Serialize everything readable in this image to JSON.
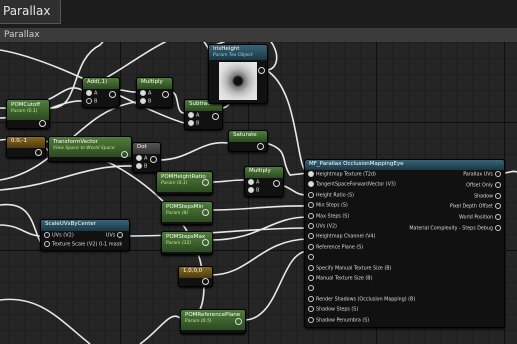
{
  "tab": {
    "title": "Parallax"
  },
  "breadcrumb": "Parallax",
  "nodes": {
    "add": {
      "title": "Add(,1)",
      "pins": [
        "A",
        "B"
      ]
    },
    "multiply1": {
      "title": "Multiply",
      "pins": [
        "A",
        "B"
      ]
    },
    "subtract": {
      "title": "Subtract",
      "pins": [
        "A",
        "B"
      ]
    },
    "iris": {
      "title": "IrisHeight",
      "sub": "Param Tex Object"
    },
    "pomcutoff": {
      "title": "POMCutoff",
      "sub": "Param (0.1)"
    },
    "const": {
      "title": "0.0,-1"
    },
    "transform": {
      "title": "TransformVector",
      "sub": "View Space to World Space"
    },
    "dot": {
      "title": "Dot",
      "pins": [
        "A",
        "B"
      ]
    },
    "saturate": {
      "title": "Saturate"
    },
    "multiply2": {
      "title": "Multiply",
      "pins": [
        "A",
        "B"
      ]
    },
    "heightratio": {
      "title": "POMHeightRatio",
      "sub": "Param (0.1)"
    },
    "stepsmin": {
      "title": "POMStepsMin",
      "sub": "Param (8)"
    },
    "stepsmax": {
      "title": "POMStepsMax",
      "sub": "Param (32)"
    },
    "scaleuv": {
      "title": "ScaleUVsByCenter",
      "pins": [
        "UVs (V2)",
        "Texture Scale (V2) 0-1 mask"
      ],
      "out": "UVs"
    },
    "constval": {
      "title": "1,0,0,0"
    },
    "refplane": {
      "title": "POMReferencePlane",
      "sub": "Param (0.5)"
    },
    "mf": {
      "title": "MF_Parallax OcclusionMappingEye",
      "inputs": [
        "Heightmap Texture (T2d)",
        "TangentSpaceForwardVector (V3)",
        "Height Ratio (S)",
        "Min Steps (S)",
        "Max Steps (S)",
        "UVs (V2)",
        "Heightmap Channel (V4)",
        "Reference Plane (S)",
        "",
        "Specify Manual Texture Size (B)",
        "Manual Texture Size (B)",
        "",
        "Render Shadows (Occlusion Mapping) (B)",
        "Shadow Steps (S)",
        "Shadow Penumbra (S)"
      ],
      "outputs": [
        "Parallax UVs",
        "Offset Only",
        "Shadow",
        "Pixel Depth Offset",
        "World Position",
        "Material Complexity - Steps Debug"
      ]
    }
  }
}
